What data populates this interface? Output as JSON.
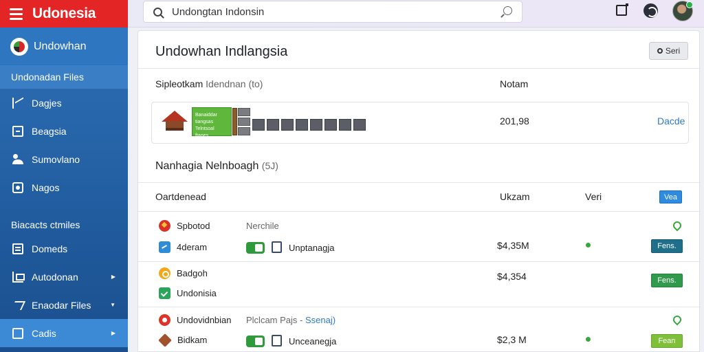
{
  "app": {
    "title": "Udonesia"
  },
  "search": {
    "value": "Undongtan Indonsin",
    "placeholder": ""
  },
  "sidebar": {
    "header": "Undowhan",
    "section": "Undonadan Files",
    "items": [
      {
        "label": "Dagjes",
        "icon": "pages-icon"
      },
      {
        "label": "Beagsia",
        "icon": "document-icon"
      },
      {
        "label": "Sumovlano",
        "icon": "users-icon"
      },
      {
        "label": "Nagos",
        "icon": "camera-icon"
      }
    ],
    "group": "Biacacts ctmiles",
    "group_items": [
      {
        "label": "Domeds",
        "icon": "folder-icon"
      },
      {
        "label": "Autodonan",
        "icon": "automation-icon"
      },
      {
        "label": "Enaodar Files",
        "icon": "files-icon"
      },
      {
        "label": "Cadis",
        "icon": "cards-icon"
      }
    ]
  },
  "main": {
    "title": "Undowhan Indlangsia",
    "serv_button": "Seri",
    "section1": {
      "label": "Sipleotkam",
      "muted": "Idendnan (to)",
      "total_header": "Notam"
    },
    "card": {
      "green_text": "Banaiddar tiangsas\nTelntsoal ftaoes",
      "amount": "201,98",
      "link": "Dacde"
    },
    "section2": {
      "label": "Nanhagia Nelnboagh",
      "muted": "(5J)"
    },
    "table": {
      "headers": [
        "Oartdenead",
        "Ukzam",
        "Veri"
      ],
      "header_button": "Vea",
      "rows": [
        {
          "name": "Spbotod",
          "sub": "Nerchile"
        },
        {
          "name": "4deram",
          "toggle_label": "Unptanagja",
          "amount": "$4,35M",
          "action": "Fens."
        },
        {
          "name": "Badgoh",
          "amount": "$4,354"
        },
        {
          "name": "Undonisia",
          "action": "Fens."
        },
        {
          "name": "Undovidnbian",
          "sub": "Plclcam Pajs -",
          "sub_link": "Ssenaj)"
        },
        {
          "name": "Bidkam",
          "toggle_label": "Unceanegja",
          "amount": "$2,3 M",
          "action": "Fean"
        }
      ]
    }
  },
  "colors": {
    "brand_red": "#e42525",
    "sidebar_blue": "#215da0",
    "accent_blue": "#2f8be0",
    "green": "#2f9a3c"
  }
}
